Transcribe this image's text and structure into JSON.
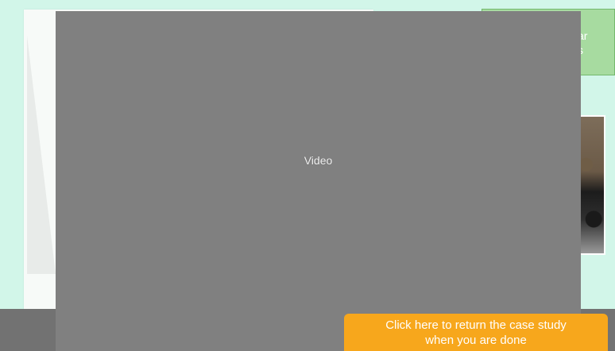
{
  "background_slide": {
    "green_card_text": [
      "ar",
      "s"
    ]
  },
  "video": {
    "label": "Video"
  },
  "return_button": {
    "line1": "Click here to return the case study",
    "line2": "when you are done"
  }
}
